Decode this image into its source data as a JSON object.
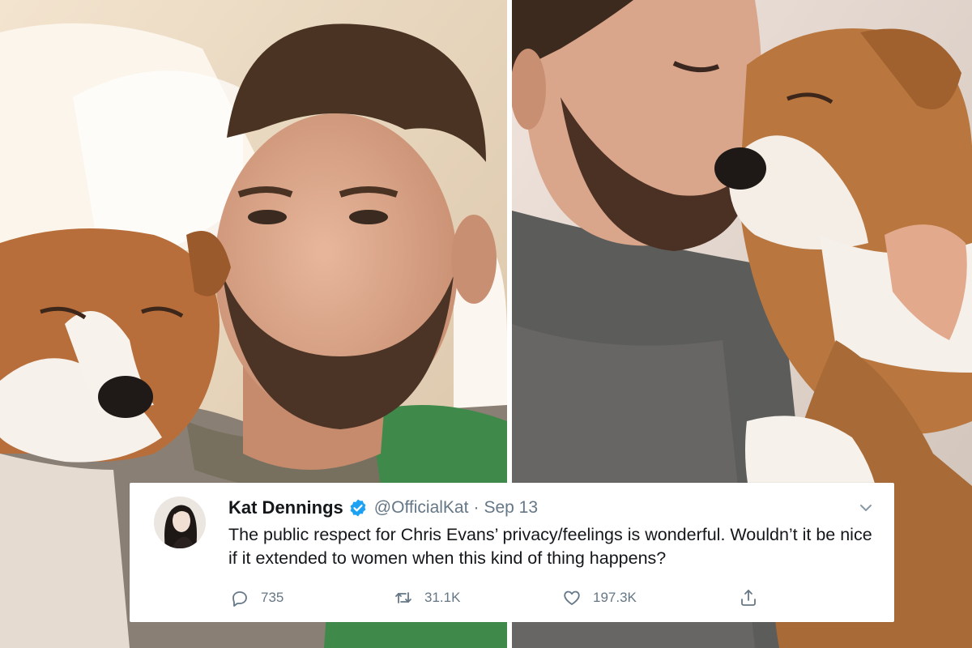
{
  "photos": {
    "left": {
      "subject": "man-with-dog-photo"
    },
    "right": {
      "subject": "man-kissing-dog-photo"
    }
  },
  "tweet": {
    "display_name": "Kat Dennings",
    "handle": "@OfficialKat",
    "separator": "·",
    "date": "Sep 13",
    "text": "The public respect for Chris Evans’ privacy/feelings is wonderful. Wouldn’t it be nice if it extended to women when this kind of thing happens?",
    "replies": "735",
    "retweets": "31.1K",
    "likes": "197.3K",
    "icons": {
      "verified": "verified-badge-icon",
      "caret": "chevron-down-icon",
      "reply": "reply-icon",
      "retweet": "retweet-icon",
      "like": "heart-icon",
      "share": "share-icon"
    }
  },
  "colors": {
    "verified_blue": "#1da1f2",
    "text_primary": "#14171a",
    "text_secondary": "#657786",
    "card_background": "#ffffff"
  }
}
